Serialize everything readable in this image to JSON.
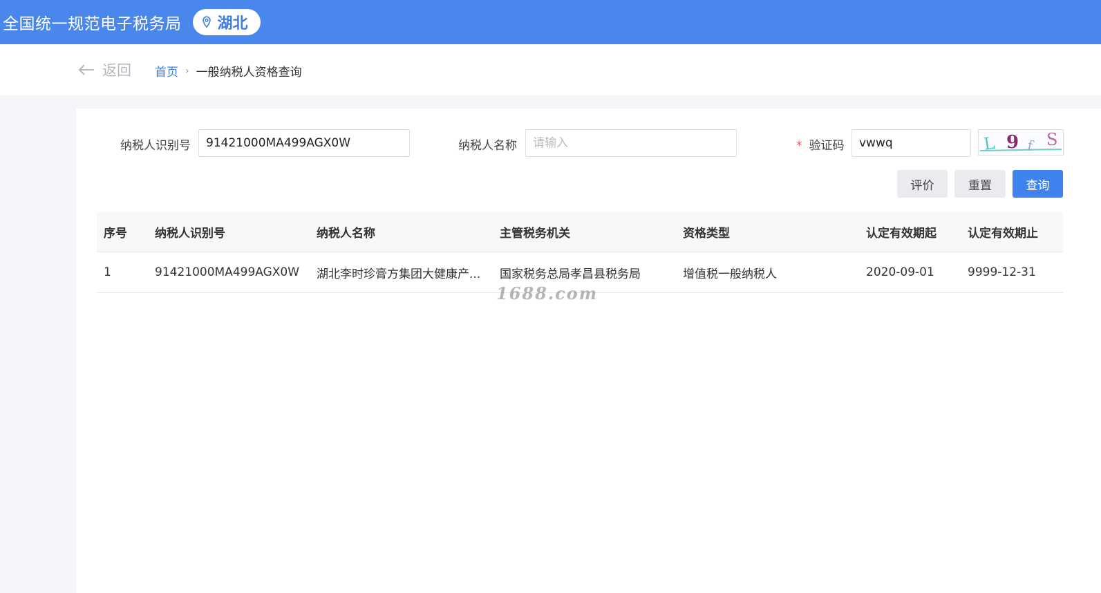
{
  "header": {
    "title": "全国统一规范电子税务局",
    "region": "湖北"
  },
  "nav": {
    "back_label": "返回",
    "breadcrumb_home": "首页",
    "breadcrumb_sep": "›",
    "breadcrumb_current": "一般纳税人资格查询"
  },
  "form": {
    "taxpayer_id_label": "纳税人识别号",
    "taxpayer_id_value": "91421000MA499AGX0W",
    "taxpayer_name_label": "纳税人名称",
    "taxpayer_name_placeholder": "请输入",
    "captcha_required_mark": "*",
    "captcha_label": "验证码",
    "captcha_value": "vwwq",
    "captcha_image_text": "L9fS"
  },
  "buttons": {
    "evaluate": "评价",
    "reset": "重置",
    "query": "查询"
  },
  "table": {
    "headers": [
      "序号",
      "纳税人识别号",
      "纳税人名称",
      "主管税务机关",
      "资格类型",
      "认定有效期起",
      "认定有效期止"
    ],
    "rows": [
      [
        "1",
        "91421000MA499AGX0W",
        "湖北李时珍膏方集团大健康产...",
        "国家税务总局孝昌县税务局",
        "增值税一般纳税人",
        "2020-09-01",
        "9999-12-31"
      ]
    ]
  },
  "watermark": "1688.com",
  "colors": {
    "header_bg": "#4a87ec",
    "primary": "#3f83ef",
    "link": "#3b7ce8",
    "required": "#e85c5c"
  }
}
